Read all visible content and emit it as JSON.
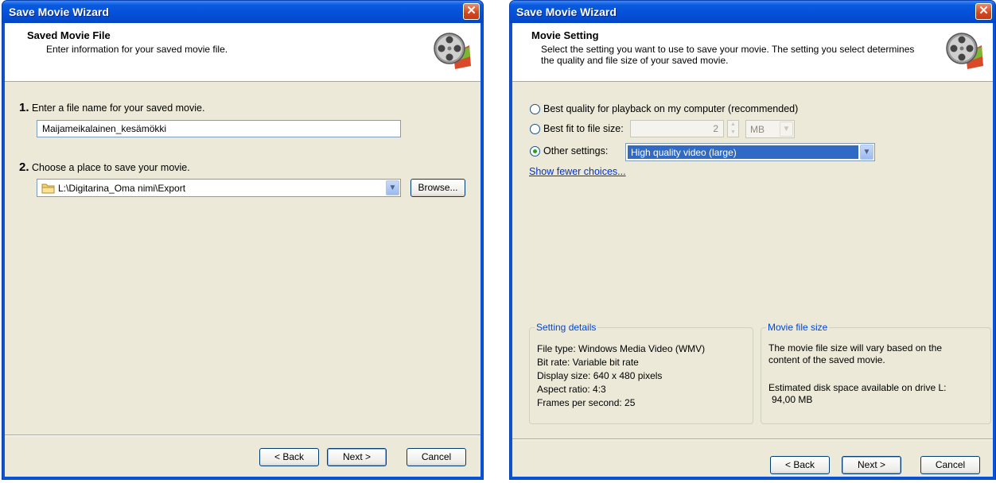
{
  "left": {
    "title": "Save Movie Wizard",
    "close_symbol": "✕",
    "header": {
      "title": "Saved Movie File",
      "subtitle": "Enter information for your saved movie file.",
      "icon": "film-reel-icon"
    },
    "step1": {
      "num": "1.",
      "label": "Enter a file name for your saved movie.",
      "value": "Maijameikalainen_kesämökki"
    },
    "step2": {
      "num": "2.",
      "label": "Choose a place to save your movie.",
      "value": "L:\\Digitarina_Oma nimi\\Export",
      "icon": "folder-icon"
    },
    "browse_label": "Browse...",
    "buttons": {
      "back": "< Back",
      "next": "Next >",
      "cancel": "Cancel"
    }
  },
  "right": {
    "title": "Save Movie Wizard",
    "close_symbol": "✕",
    "header": {
      "title": "Movie Setting",
      "subtitle": "Select the setting you want to use to save your movie. The setting you select determines the quality and file size of your saved movie.",
      "icon": "film-reel-icon"
    },
    "options": {
      "best_quality": "Best quality for playback on my computer (recommended)",
      "best_fit": "Best fit to file size:",
      "fit_value": "2",
      "fit_unit": "MB",
      "other": "Other settings:",
      "other_value": "High quality video (large)"
    },
    "link": "Show fewer choices...",
    "setting_details": {
      "title": "Setting details",
      "lines": [
        "File type: Windows Media Video (WMV)",
        "Bit rate: Variable bit rate",
        "Display size: 640 x 480 pixels",
        "Aspect ratio: 4:3",
        "Frames per second: 25"
      ]
    },
    "file_size": {
      "title": "Movie file size",
      "text": "The movie file size will vary based on the content of the saved movie.",
      "disk_label": "Estimated disk space available on drive L:",
      "disk_value": "94,00 MB"
    },
    "buttons": {
      "back": "< Back",
      "next": "Next >",
      "cancel": "Cancel"
    }
  }
}
